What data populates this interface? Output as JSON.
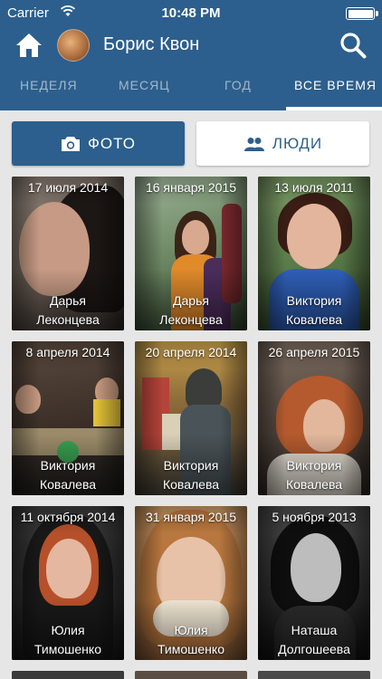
{
  "status_bar": {
    "carrier": "Carrier",
    "time": "10:48 PM"
  },
  "header": {
    "user_name": "Борис Квон"
  },
  "tabs": [
    {
      "label": "НЕДЕЛЯ"
    },
    {
      "label": "МЕСЯЦ"
    },
    {
      "label": "ГОД"
    },
    {
      "label": "ВСЕ ВРЕМЯ"
    }
  ],
  "buttons": {
    "photo": "ФОТО",
    "people": "ЛЮДИ"
  },
  "cards": [
    {
      "date": "17 июля 2014",
      "first": "Дарья",
      "last": "Леконцева"
    },
    {
      "date": "16 января 2015",
      "first": "Дарья",
      "last": "Леконцева"
    },
    {
      "date": "13 июля 2011",
      "first": "Виктория",
      "last": "Ковалева"
    },
    {
      "date": "8 апреля 2014",
      "first": "Виктория",
      "last": "Ковалева"
    },
    {
      "date": "20 апреля 2014",
      "first": "Виктория",
      "last": "Ковалева"
    },
    {
      "date": "26 апреля 2015",
      "first": "Виктория",
      "last": "Ковалева"
    },
    {
      "date": "11 октября 2014",
      "first": "Юлия",
      "last": "Тимошенко"
    },
    {
      "date": "31 января 2015",
      "first": "Юлия",
      "last": "Тимошенко"
    },
    {
      "date": "5 ноября 2013",
      "first": "Наташа",
      "last": "Долгошеева"
    }
  ],
  "colors": {
    "primary": "#2c5f8d",
    "background": "#e6e6e6"
  },
  "icons": [
    "wifi-icon",
    "home-icon",
    "search-icon",
    "camera-icon",
    "people-icon"
  ]
}
